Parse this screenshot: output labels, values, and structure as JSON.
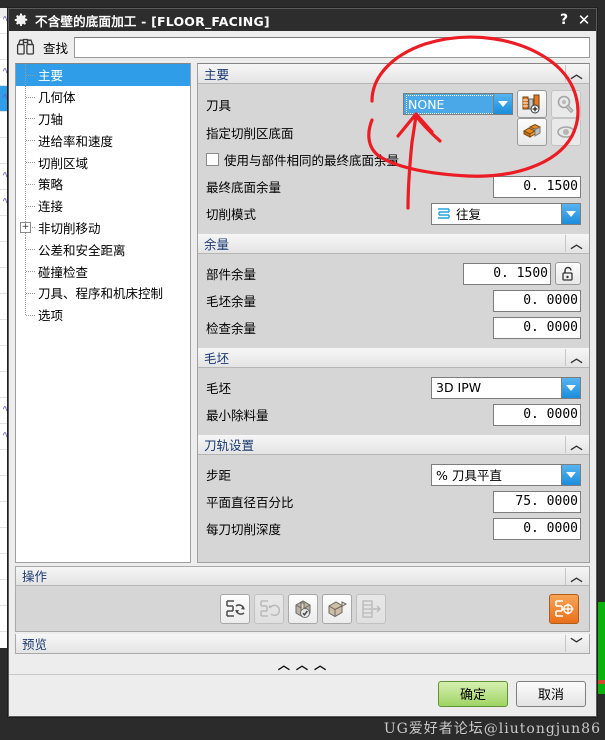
{
  "window": {
    "title": "不含壁的底面加工 - [FLOOR_FACING]",
    "icon": "gear-icon",
    "help_label": "?",
    "close_label": "✕"
  },
  "find": {
    "label": "查找",
    "value": "",
    "placeholder": "",
    "icon": "binoculars-icon"
  },
  "tree": {
    "items": [
      {
        "label": "主要",
        "selected": true,
        "expandable": false
      },
      {
        "label": "几何体",
        "selected": false,
        "expandable": false
      },
      {
        "label": "刀轴",
        "selected": false,
        "expandable": false
      },
      {
        "label": "进给率和速度",
        "selected": false,
        "expandable": false
      },
      {
        "label": "切削区域",
        "selected": false,
        "expandable": false
      },
      {
        "label": "策略",
        "selected": false,
        "expandable": false
      },
      {
        "label": "连接",
        "selected": false,
        "expandable": false
      },
      {
        "label": "非切削移动",
        "selected": false,
        "expandable": true,
        "expander": "+"
      },
      {
        "label": "公差和安全距离",
        "selected": false,
        "expandable": false
      },
      {
        "label": "碰撞检查",
        "selected": false,
        "expandable": false
      },
      {
        "label": "刀具、程序和机床控制",
        "selected": false,
        "expandable": false
      },
      {
        "label": "选项",
        "selected": false,
        "expandable": false
      }
    ]
  },
  "groups": {
    "main": {
      "title": "主要",
      "chevron": "︿",
      "tool": {
        "label": "刀具",
        "value": "NONE",
        "new_tool_icon": "new-tool-icon",
        "edit_tool_icon": "edit-tool-icon"
      },
      "floor_geometry": {
        "label": "指定切削区底面",
        "select_icon": "select-floor-icon",
        "display_icon": "show-floor-icon"
      },
      "same_stock_checkbox": {
        "label": "使用与部件相同的最终底面余量",
        "checked": false
      },
      "final_floor_stock": {
        "label": "最终底面余量",
        "value": "0. 1500"
      },
      "cut_pattern": {
        "label": "切削模式",
        "value": "往复",
        "icon": "zigzag-icon"
      }
    },
    "stock": {
      "title": "余量",
      "chevron": "︿",
      "part_stock": {
        "label": "部件余量",
        "value": "0. 1500",
        "lock_icon": "unlock-icon"
      },
      "blank_stock": {
        "label": "毛坯余量",
        "value": "0. 0000"
      },
      "check_stock": {
        "label": "检查余量",
        "value": "0. 0000"
      }
    },
    "blank": {
      "title": "毛坯",
      "chevron": "︿",
      "blank_type": {
        "label": "毛坯",
        "value": "3D IPW"
      },
      "min_removal": {
        "label": "最小除料量",
        "value": "0. 0000"
      }
    },
    "toolpath": {
      "title": "刀轨设置",
      "chevron": "︿",
      "stepover": {
        "label": "步距",
        "value": "% 刀具平直"
      },
      "flat_dia_pct": {
        "label": "平面直径百分比",
        "value": "75. 0000"
      },
      "depth_per_cut": {
        "label": "每刀切削深度",
        "value": "0. 0000"
      }
    },
    "operation": {
      "title": "操作",
      "chevron": "︿",
      "buttons": [
        {
          "name": "generate-toolpath-icon",
          "enabled": true
        },
        {
          "name": "replay-toolpath-icon",
          "enabled": false
        },
        {
          "name": "verify-toolpath-icon",
          "enabled": true
        },
        {
          "name": "simulate-material-icon",
          "enabled": true
        },
        {
          "name": "list-toolpath-icon",
          "enabled": false
        }
      ],
      "accent_button": {
        "name": "confirm-toolpath-icon",
        "enabled": true
      }
    },
    "preview": {
      "title": "预览",
      "chevron": "﹀"
    }
  },
  "resize_handle": {
    "glyphs": "︿ ︿ ︿"
  },
  "footer": {
    "ok_label": "确定",
    "cancel_label": "取消"
  },
  "watermark": {
    "text": "UG爱好者论坛@liutongjun86"
  },
  "colors": {
    "titlebar": "#2d2d2d",
    "selection_blue": "#2f9de8",
    "group_title": "#1b3a73",
    "accent_orange": "#e8701a",
    "ok_green": "#9fd465",
    "annotation_red": "#ec1c24"
  }
}
